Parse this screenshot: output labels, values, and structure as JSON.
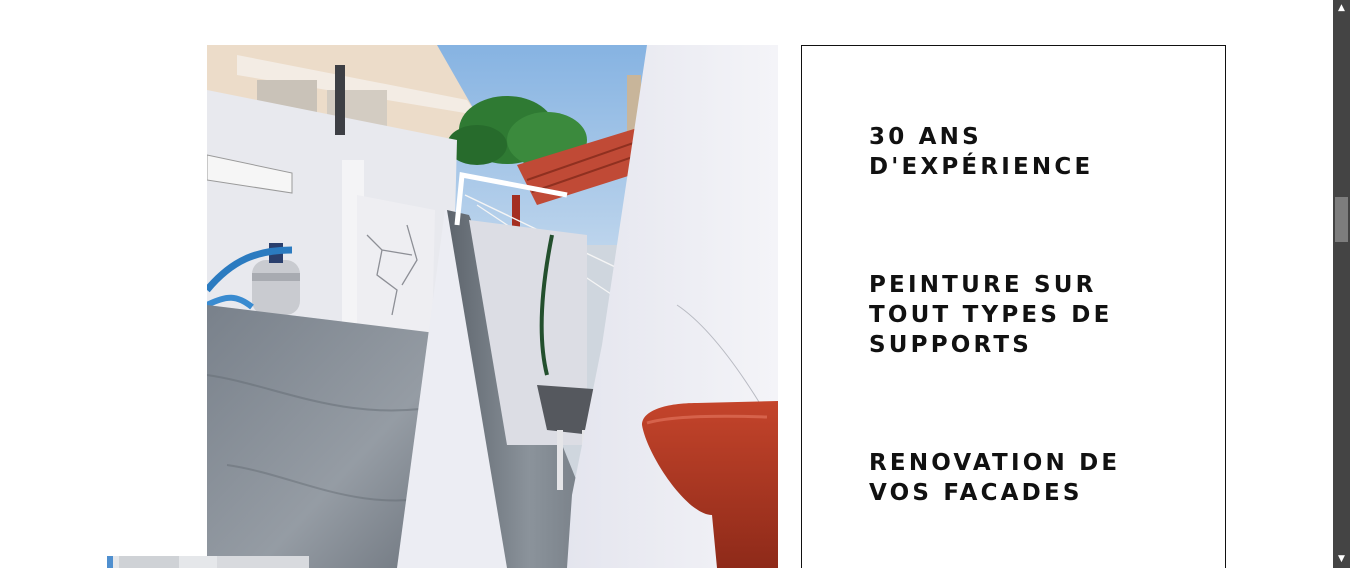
{
  "photo": {
    "subject": "rooftop-terrace-photo"
  },
  "thumbnail": {
    "subject": "partial-thumbnail-photo"
  },
  "features": {
    "items": [
      {
        "label": "30 ANS\nD'EXPÉRIENCE"
      },
      {
        "label": "PEINTURE SUR\nTOUT TYPES DE\nSUPPORTS"
      },
      {
        "label": "RENOVATION DE\nVOS FACADES"
      }
    ],
    "border_color": "#111111",
    "text_color": "#111111"
  },
  "scrollbar": {
    "up_icon": "triangle-up-icon",
    "down_icon": "triangle-down-icon",
    "track_color": "#444444",
    "thumb_color": "#7d7d7d"
  }
}
